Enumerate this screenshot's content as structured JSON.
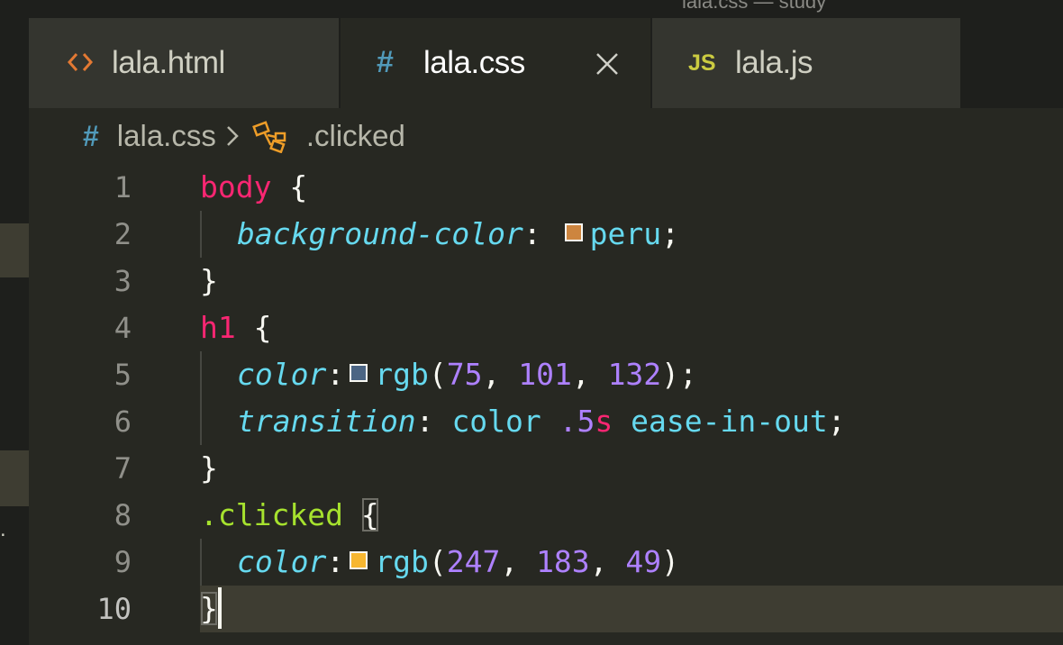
{
  "window": {
    "title": "lala.css — study"
  },
  "tabs": [
    {
      "label": "lala.html",
      "icon": "html-code-icon",
      "active": false
    },
    {
      "label": "lala.css",
      "icon": "css-hash-icon",
      "active": true
    },
    {
      "label": "lala.js",
      "icon": "js-file-icon",
      "active": false
    }
  ],
  "breadcrumb": {
    "file": "lala.css",
    "symbol": ".clicked",
    "file_icon": "#"
  },
  "icon_glyphs": {
    "hash": "#",
    "js": "JS",
    "html": "<>"
  },
  "colors": {
    "peru": "#cd853f",
    "rgb_75_101_132": "#4b6584",
    "rgb_247_183_49": "#f7b731",
    "css_icon": "#519aba",
    "html_icon": "#e37933",
    "js_icon": "#cbcb41",
    "selector": "#f92672",
    "class_selector": "#a6e22e",
    "property": "#66d9ef",
    "number": "#ae81ff"
  },
  "line_numbers": [
    "1",
    "2",
    "3",
    "4",
    "5",
    "6",
    "7",
    "8",
    "9",
    "10"
  ],
  "code": {
    "l1": {
      "selector": "body",
      "open": " {"
    },
    "l2": {
      "property": "background-color",
      "colon": ": ",
      "value": "peru",
      "end": ";"
    },
    "l3": {
      "close": "}"
    },
    "l4": {
      "selector": "h1",
      "open": " {"
    },
    "l5": {
      "property": "color",
      "colon": ":",
      "fn": "rgb",
      "lp": "(",
      "n1": "75",
      "c1": ", ",
      "n2": "101",
      "c2": ", ",
      "n3": "132",
      "end": ");"
    },
    "l6": {
      "property": "transition",
      "colon": ": ",
      "v1": "color",
      "sp1": " ",
      "num": ".5",
      "unit": "s",
      "sp2": " ",
      "v2": "ease-in-out",
      "end": ";"
    },
    "l7": {
      "close": "}"
    },
    "l8": {
      "selector": ".clicked",
      "space": " ",
      "open": "{"
    },
    "l9": {
      "property": "color",
      "colon": ":",
      "fn": "rgb",
      "lp": "(",
      "n1": "247",
      "c1": ", ",
      "n2": "183",
      "c2": ", ",
      "n3": "49",
      "rp": ")"
    },
    "l10": {
      "close": "}"
    }
  }
}
